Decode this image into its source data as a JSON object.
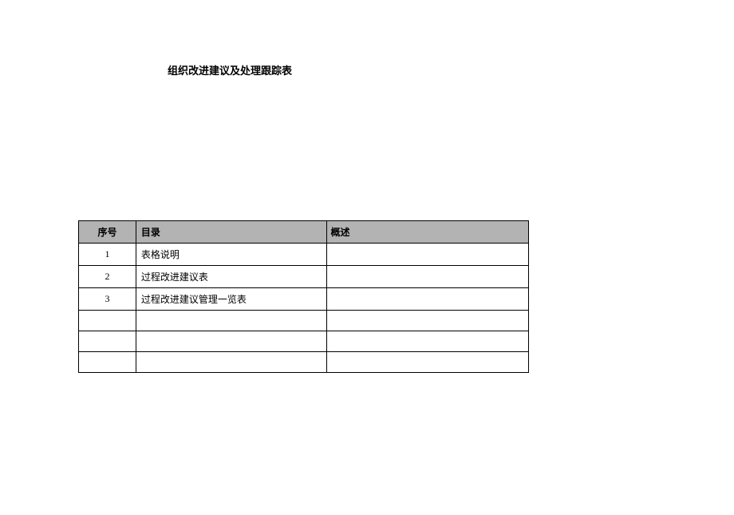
{
  "title": "组织改进建议及处理跟踪表",
  "headers": {
    "seq": "序号",
    "dir": "目录",
    "desc": "概述"
  },
  "rows": [
    {
      "seq": "1",
      "dir": "表格说明",
      "desc": ""
    },
    {
      "seq": "2",
      "dir": "过程改进建议表",
      "desc": ""
    },
    {
      "seq": "3",
      "dir": "过程改进建议管理一览表",
      "desc": ""
    },
    {
      "seq": "",
      "dir": "",
      "desc": ""
    },
    {
      "seq": "",
      "dir": "",
      "desc": ""
    },
    {
      "seq": "",
      "dir": "",
      "desc": ""
    }
  ]
}
